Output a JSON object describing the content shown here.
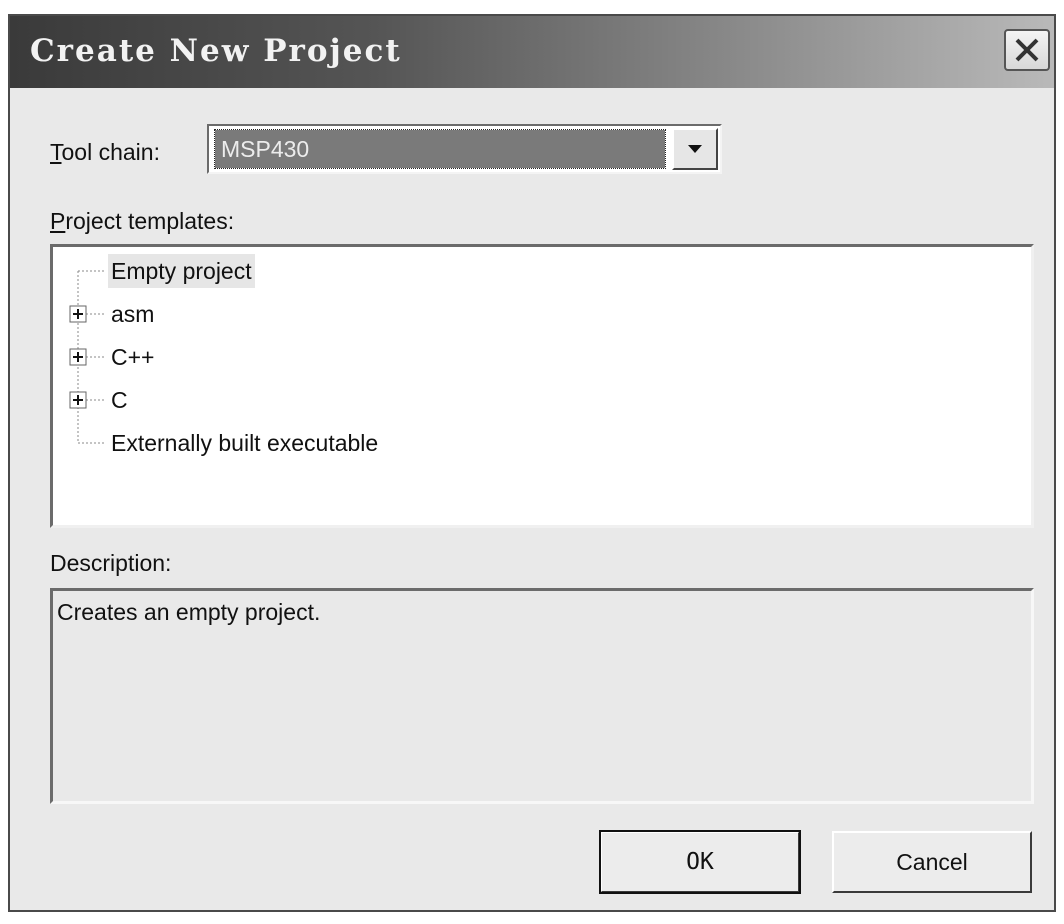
{
  "window": {
    "title": "Create New Project",
    "close_glyph": "✕"
  },
  "toolchain": {
    "label_accel": "T",
    "label_rest": "ool chain:",
    "selected_value": "MSP430"
  },
  "templates": {
    "label_accel": "P",
    "label_rest": "roject templates:",
    "items": [
      {
        "label": "Empty project",
        "expandable": false,
        "selected": true
      },
      {
        "label": "asm",
        "expandable": true,
        "selected": false
      },
      {
        "label": "C++",
        "expandable": true,
        "selected": false
      },
      {
        "label": "C",
        "expandable": true,
        "selected": false
      },
      {
        "label": "Externally built executable",
        "expandable": false,
        "selected": false
      }
    ]
  },
  "description": {
    "label": "Description:",
    "text": "Creates an empty project."
  },
  "buttons": {
    "ok_label": "OK",
    "cancel_label": "Cancel"
  },
  "icons": {
    "close": "close-icon",
    "dropdown": "chevron-down-icon",
    "expand": "plus-icon"
  }
}
